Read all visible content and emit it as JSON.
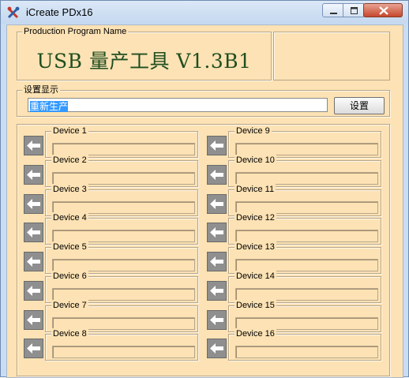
{
  "window": {
    "title": "iCreate PDx16",
    "icon": "app-tools-icon",
    "controls": [
      "minimize-icon",
      "maximize-icon",
      "close-icon"
    ]
  },
  "banner": {
    "group_label": "Production Program Name",
    "title": "USB 量产工具 V1.3B1"
  },
  "settings": {
    "group_label": "设置显示",
    "mode_value": "重新生产",
    "button_label": "设置"
  },
  "devices": [
    {
      "label": "Device 1",
      "value": ""
    },
    {
      "label": "Device 2",
      "value": ""
    },
    {
      "label": "Device 3",
      "value": ""
    },
    {
      "label": "Device 4",
      "value": ""
    },
    {
      "label": "Device 5",
      "value": ""
    },
    {
      "label": "Device 6",
      "value": ""
    },
    {
      "label": "Device 7",
      "value": ""
    },
    {
      "label": "Device 8",
      "value": ""
    },
    {
      "label": "Device 9",
      "value": ""
    },
    {
      "label": "Device 10",
      "value": ""
    },
    {
      "label": "Device 11",
      "value": ""
    },
    {
      "label": "Device 12",
      "value": ""
    },
    {
      "label": "Device 13",
      "value": ""
    },
    {
      "label": "Device 14",
      "value": ""
    },
    {
      "label": "Device 15",
      "value": ""
    },
    {
      "label": "Device 16",
      "value": ""
    }
  ],
  "colors": {
    "client_bg": "#fce2b4",
    "banner_text": "#1f4e1f",
    "selection": "#3399ff",
    "close_button": "#c7462c"
  }
}
